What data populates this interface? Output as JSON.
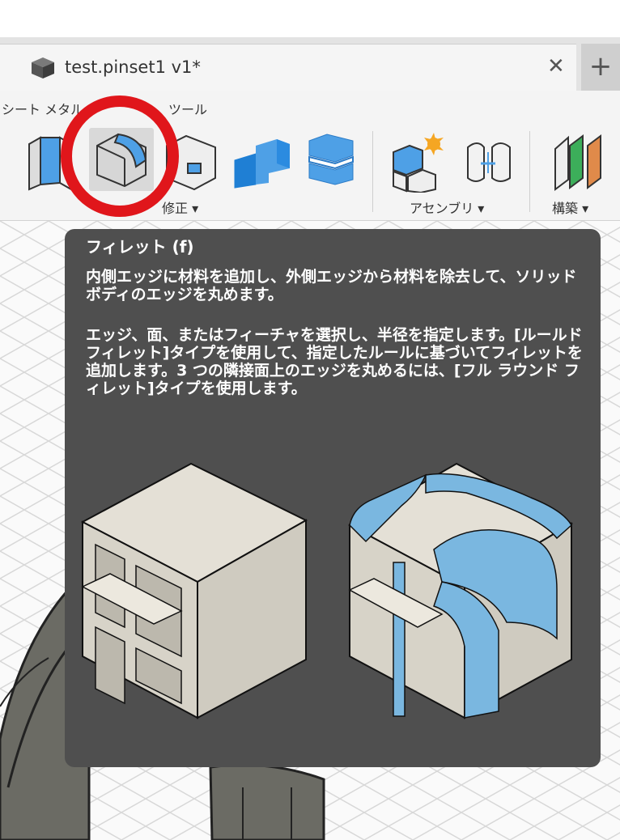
{
  "tab": {
    "title": "test.pinset1 v1*",
    "close_label": "✕",
    "new_tab_label": "+"
  },
  "toolbar": {
    "workspace_tabs": [
      "シート メタル",
      "ツール"
    ],
    "groups": [
      {
        "label": "修正 ▾"
      },
      {
        "label": "アセンブリ ▾"
      },
      {
        "label": "構築 ▾"
      }
    ]
  },
  "tooltip": {
    "title": "フィレット (f)",
    "para1": "内側エッジに材料を追加し、外側エッジから材料を除去して、ソリッド ボディのエッジを丸めます。",
    "para2": "エッジ、面、またはフィーチャを選択し、半径を指定します。[ルールド フィレット]タイプを使用して、指定したルールに基づいてフィレットを追加します。3 つの隣接面上のエッジを丸めるには、[フル ラウンド フィレット]タイプを使用します。"
  },
  "icons": [
    "box-icon",
    "press-pull-icon",
    "fillet-icon",
    "chamfer-icon",
    "combine-icon",
    "offset-face-icon",
    "joint-icon",
    "rigid-group-icon",
    "offset-plane-icon"
  ],
  "colors": {
    "accent_blue": "#4ea0e6",
    "tooltip_bg": "#4f4f4f",
    "annotation_red": "#e0161b"
  }
}
